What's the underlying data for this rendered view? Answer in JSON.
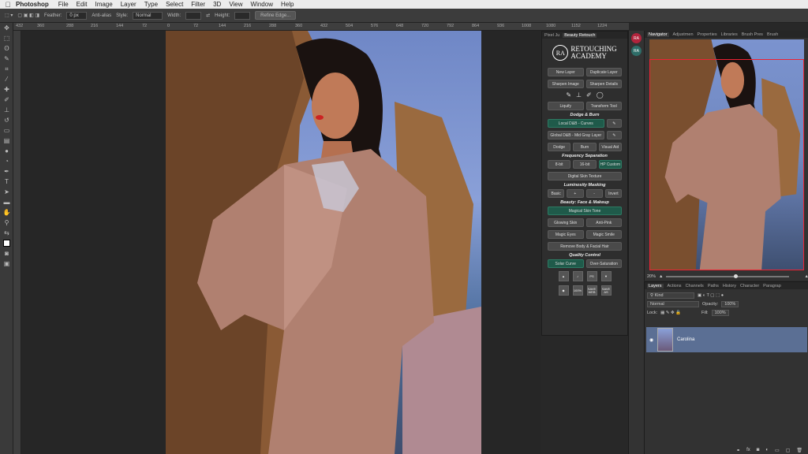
{
  "menubar": {
    "app": "Photoshop",
    "items": [
      "File",
      "Edit",
      "Image",
      "Layer",
      "Type",
      "Select",
      "Filter",
      "3D",
      "View",
      "Window",
      "Help"
    ]
  },
  "options": {
    "feather_label": "Feather:",
    "feather_value": "0 px",
    "antialias": "Anti-alias",
    "style_label": "Style:",
    "style_value": "Normal",
    "width_label": "Width:",
    "height_label": "Height:",
    "refine_edge": "Refine Edge..."
  },
  "ruler_ticks": [
    "432",
    "360",
    "288",
    "216",
    "144",
    "72",
    "0",
    "72",
    "144",
    "216",
    "288",
    "360",
    "432",
    "504",
    "576",
    "648",
    "720",
    "792",
    "864",
    "936",
    "1008",
    "1080",
    "1152",
    "1224"
  ],
  "ext": {
    "tabs": [
      "Pixel Ju",
      "Beauty Retouch"
    ],
    "logo_mark": "RA",
    "logo_line1": "RETOUCHING",
    "logo_line2": "ACADEMY",
    "new_layer": "New Layer",
    "duplicate_layer": "Duplicate Layer",
    "sharpen_image": "Sharpen Image",
    "sharpen_details": "Sharpen Details",
    "liquify": "Liquify",
    "transform_tool": "Transform Tool",
    "dodge_burn_head": "Dodge & Burn",
    "local_db": "Local D&B - Curves",
    "global_db": "Global D&B - Mid Gray Layer",
    "dodge": "Dodge",
    "burn": "Burn",
    "visual_aid": "Visual Aid",
    "freq_head": "Frequency Separation",
    "bit8": "8-bit",
    "bit16": "16-bit",
    "hp_custom": "HP Custom",
    "digital_skin": "Digital Skin Texture",
    "lum_head": "Luminosity Masking",
    "basic": "Basic",
    "plus": "+",
    "minus": "-",
    "invert": "Invert",
    "beauty_head": "Beauty: Face & Makeup",
    "magical_skin": "Magical Skin Tone",
    "glowing_skin": "Glowing Skin",
    "anti_pink": "Anti-Pink",
    "magic_eyes": "Magic Eyes",
    "magic_smile": "Magic Smile",
    "remove_hair": "Remove Body & Facial Hair",
    "qc_head": "Quality Control",
    "solar_curve": "Solar Curve",
    "over_saturation": "Over-Saturation",
    "qc_icons": [
      "▲",
      "♪",
      "PS",
      "▼",
      "◆",
      "100%",
      "SAVE WEB",
      "SAVE AS"
    ]
  },
  "dock": {
    "badge": "RA"
  },
  "navigator": {
    "tabs": [
      "Navigator",
      "Adjustmen",
      "Properties",
      "Libraries",
      "Brush Pres",
      "Brush"
    ],
    "zoom": "20%"
  },
  "layers": {
    "tabs": [
      "Layers",
      "Actions",
      "Channels",
      "Paths",
      "History",
      "Character",
      "Paragrap"
    ],
    "kind": "Kind",
    "blend": "Normal",
    "opacity_label": "Opacity:",
    "opacity_value": "100%",
    "lock_label": "Lock:",
    "fill_label": "Fill:",
    "fill_value": "100%",
    "layer_name": "Carolina"
  }
}
